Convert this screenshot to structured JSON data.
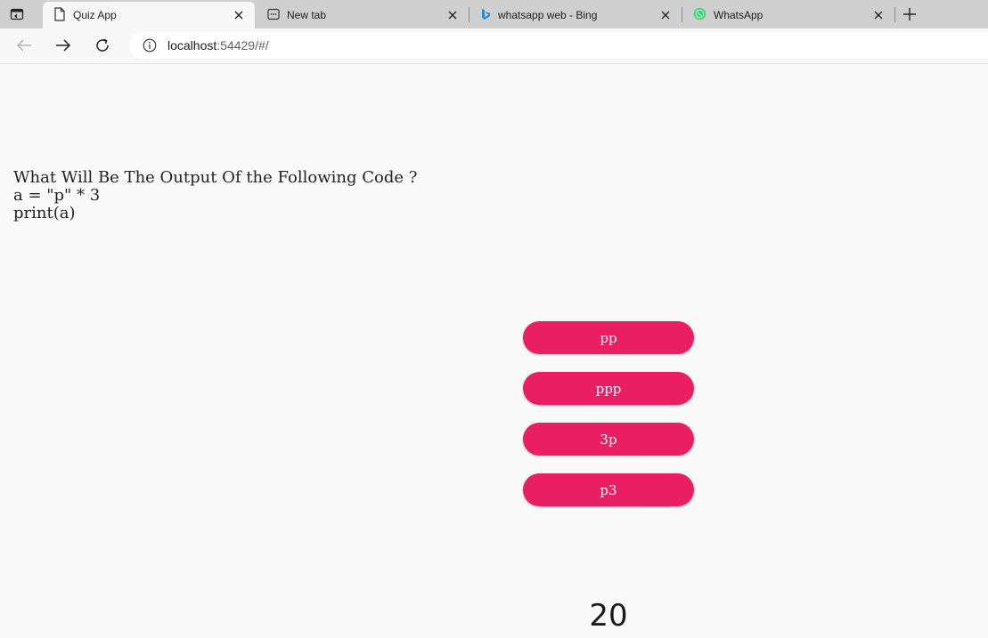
{
  "browser": {
    "tabs": [
      {
        "title": "Quiz App",
        "icon": "page-icon",
        "active": true
      },
      {
        "title": "New tab",
        "icon": "new-tab-icon",
        "active": false
      },
      {
        "title": "whatsapp web - Bing",
        "icon": "bing-icon",
        "active": false
      },
      {
        "title": "WhatsApp",
        "icon": "whatsapp-icon",
        "active": false
      }
    ],
    "address": {
      "host": "localhost",
      "rest": ":54429/#/"
    }
  },
  "quiz": {
    "question": "What Will Be The Output Of the Following Code ?\na = \"p\" * 3\nprint(a)",
    "answers": [
      "pp",
      "ppp",
      "3p",
      "p3"
    ],
    "timer": "20"
  },
  "colors": {
    "answer_bg": "#e91e63",
    "page_bg": "#f9f9f9"
  }
}
